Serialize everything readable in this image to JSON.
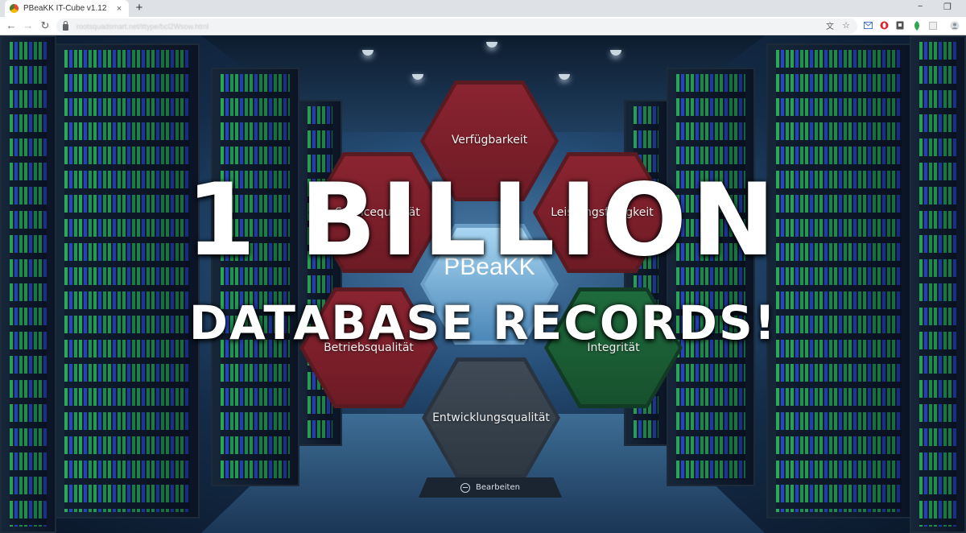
{
  "browser": {
    "tab_title": "PBeaKK IT-Cube v1.12",
    "tab_close": "×",
    "new_tab": "+",
    "url": "rootsquadsmart.net/ittype/bcl2Wsow.html",
    "window_controls": {
      "minimize": "−",
      "restore": "❐"
    }
  },
  "app": {
    "logo_text": "PBeaKK",
    "hexagons": {
      "top": "Verfügbarkeit",
      "upper_left": "Servicequalität",
      "upper_right": "Leistungsfähigkeit",
      "lower_left": "Betriebsqualität",
      "lower_right": "Integrität",
      "bottom": "Entwicklungsqualität"
    },
    "edit_button_label": "Bearbeiten"
  },
  "overlay": {
    "line1": "1 BILLION",
    "line2": "DATABASE RECORDS!"
  },
  "colors": {
    "hex_red": "#8a2430",
    "hex_green": "#1f6b3c",
    "hex_gray": "#3f4a56",
    "hex_blue": "#a8d6f2"
  }
}
